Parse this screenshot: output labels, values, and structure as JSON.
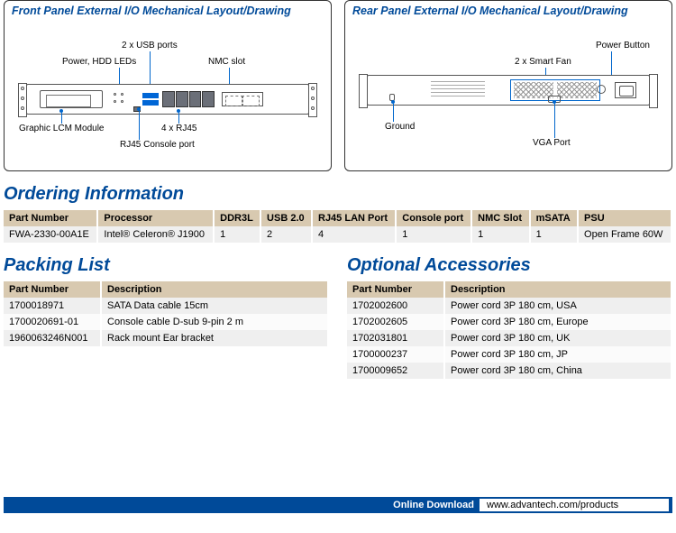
{
  "front_panel": {
    "heading": "Front Panel External I/O Mechanical Layout/Drawing",
    "labels": {
      "usb": "2 x USB ports",
      "leds": "Power, HDD LEDs",
      "nmc": "NMC slot",
      "lcm": "Graphic LCM Module",
      "rj45": "4 x RJ45",
      "console": "RJ45 Console port"
    }
  },
  "rear_panel": {
    "heading": "Rear Panel External I/O Mechanical Layout/Drawing",
    "labels": {
      "power_button": "Power Button",
      "smart_fan": "2 x Smart Fan",
      "ground": "Ground",
      "vga": "VGA Port"
    }
  },
  "ordering": {
    "heading": "Ordering Information",
    "columns": [
      "Part Number",
      "Processor",
      "DDR3L",
      "USB 2.0",
      "RJ45 LAN Port",
      "Console port",
      "NMC Slot",
      "mSATA",
      "PSU"
    ],
    "row": [
      "FWA-2330-00A1E",
      "Intel® Celeron® J1900",
      "1",
      "2",
      "4",
      "1",
      "1",
      "1",
      "Open Frame 60W"
    ]
  },
  "packing": {
    "heading": "Packing List",
    "columns": [
      "Part Number",
      "Description"
    ],
    "rows": [
      [
        "1700018971",
        "SATA Data cable 15cm"
      ],
      [
        "1700020691-01",
        "Console cable D-sub 9-pin 2 m"
      ],
      [
        "1960063246N001",
        "Rack mount Ear bracket"
      ]
    ]
  },
  "accessories": {
    "heading": "Optional Accessories",
    "columns": [
      "Part Number",
      "Description"
    ],
    "rows": [
      [
        "1702002600",
        "Power cord 3P 180 cm, USA"
      ],
      [
        "1702002605",
        "Power cord 3P 180 cm, Europe"
      ],
      [
        "1702031801",
        "Power cord 3P 180 cm, UK"
      ],
      [
        "1700000237",
        "Power cord 3P 180 cm, JP"
      ],
      [
        "1700009652",
        "Power cord 3P 180 cm, China"
      ]
    ]
  },
  "footer": {
    "label": "Online Download",
    "url": "www.advantech.com/products"
  }
}
